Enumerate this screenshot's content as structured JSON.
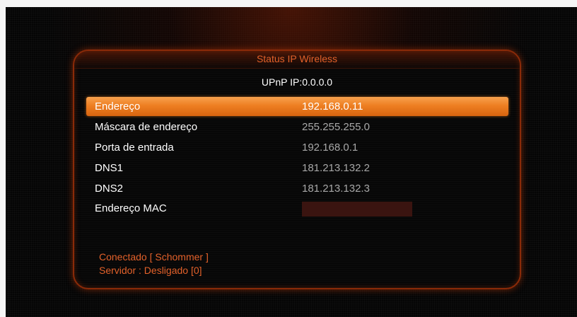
{
  "dialog": {
    "title": "Status IP Wireless",
    "upnp": "UPnP IP:0.0.0.0"
  },
  "rows": [
    {
      "label": "Endereço",
      "value": "192.168.0.11",
      "selected": true
    },
    {
      "label": "Máscara de endereço",
      "value": "255.255.255.0"
    },
    {
      "label": "Porta de entrada",
      "value": "192.168.0.1"
    },
    {
      "label": "DNS1",
      "value": "181.213.132.2"
    },
    {
      "label": "DNS2",
      "value": "181.213.132.3"
    },
    {
      "label": "Endereço MAC",
      "value": ""
    }
  ],
  "status": {
    "connection": "Conectado [ Schommer ]",
    "server": "Servidor : Desligado  [0]"
  },
  "colors": {
    "accent": "#ee7f22",
    "status_text": "#e3612a",
    "value_text": "#a8a8a8"
  }
}
